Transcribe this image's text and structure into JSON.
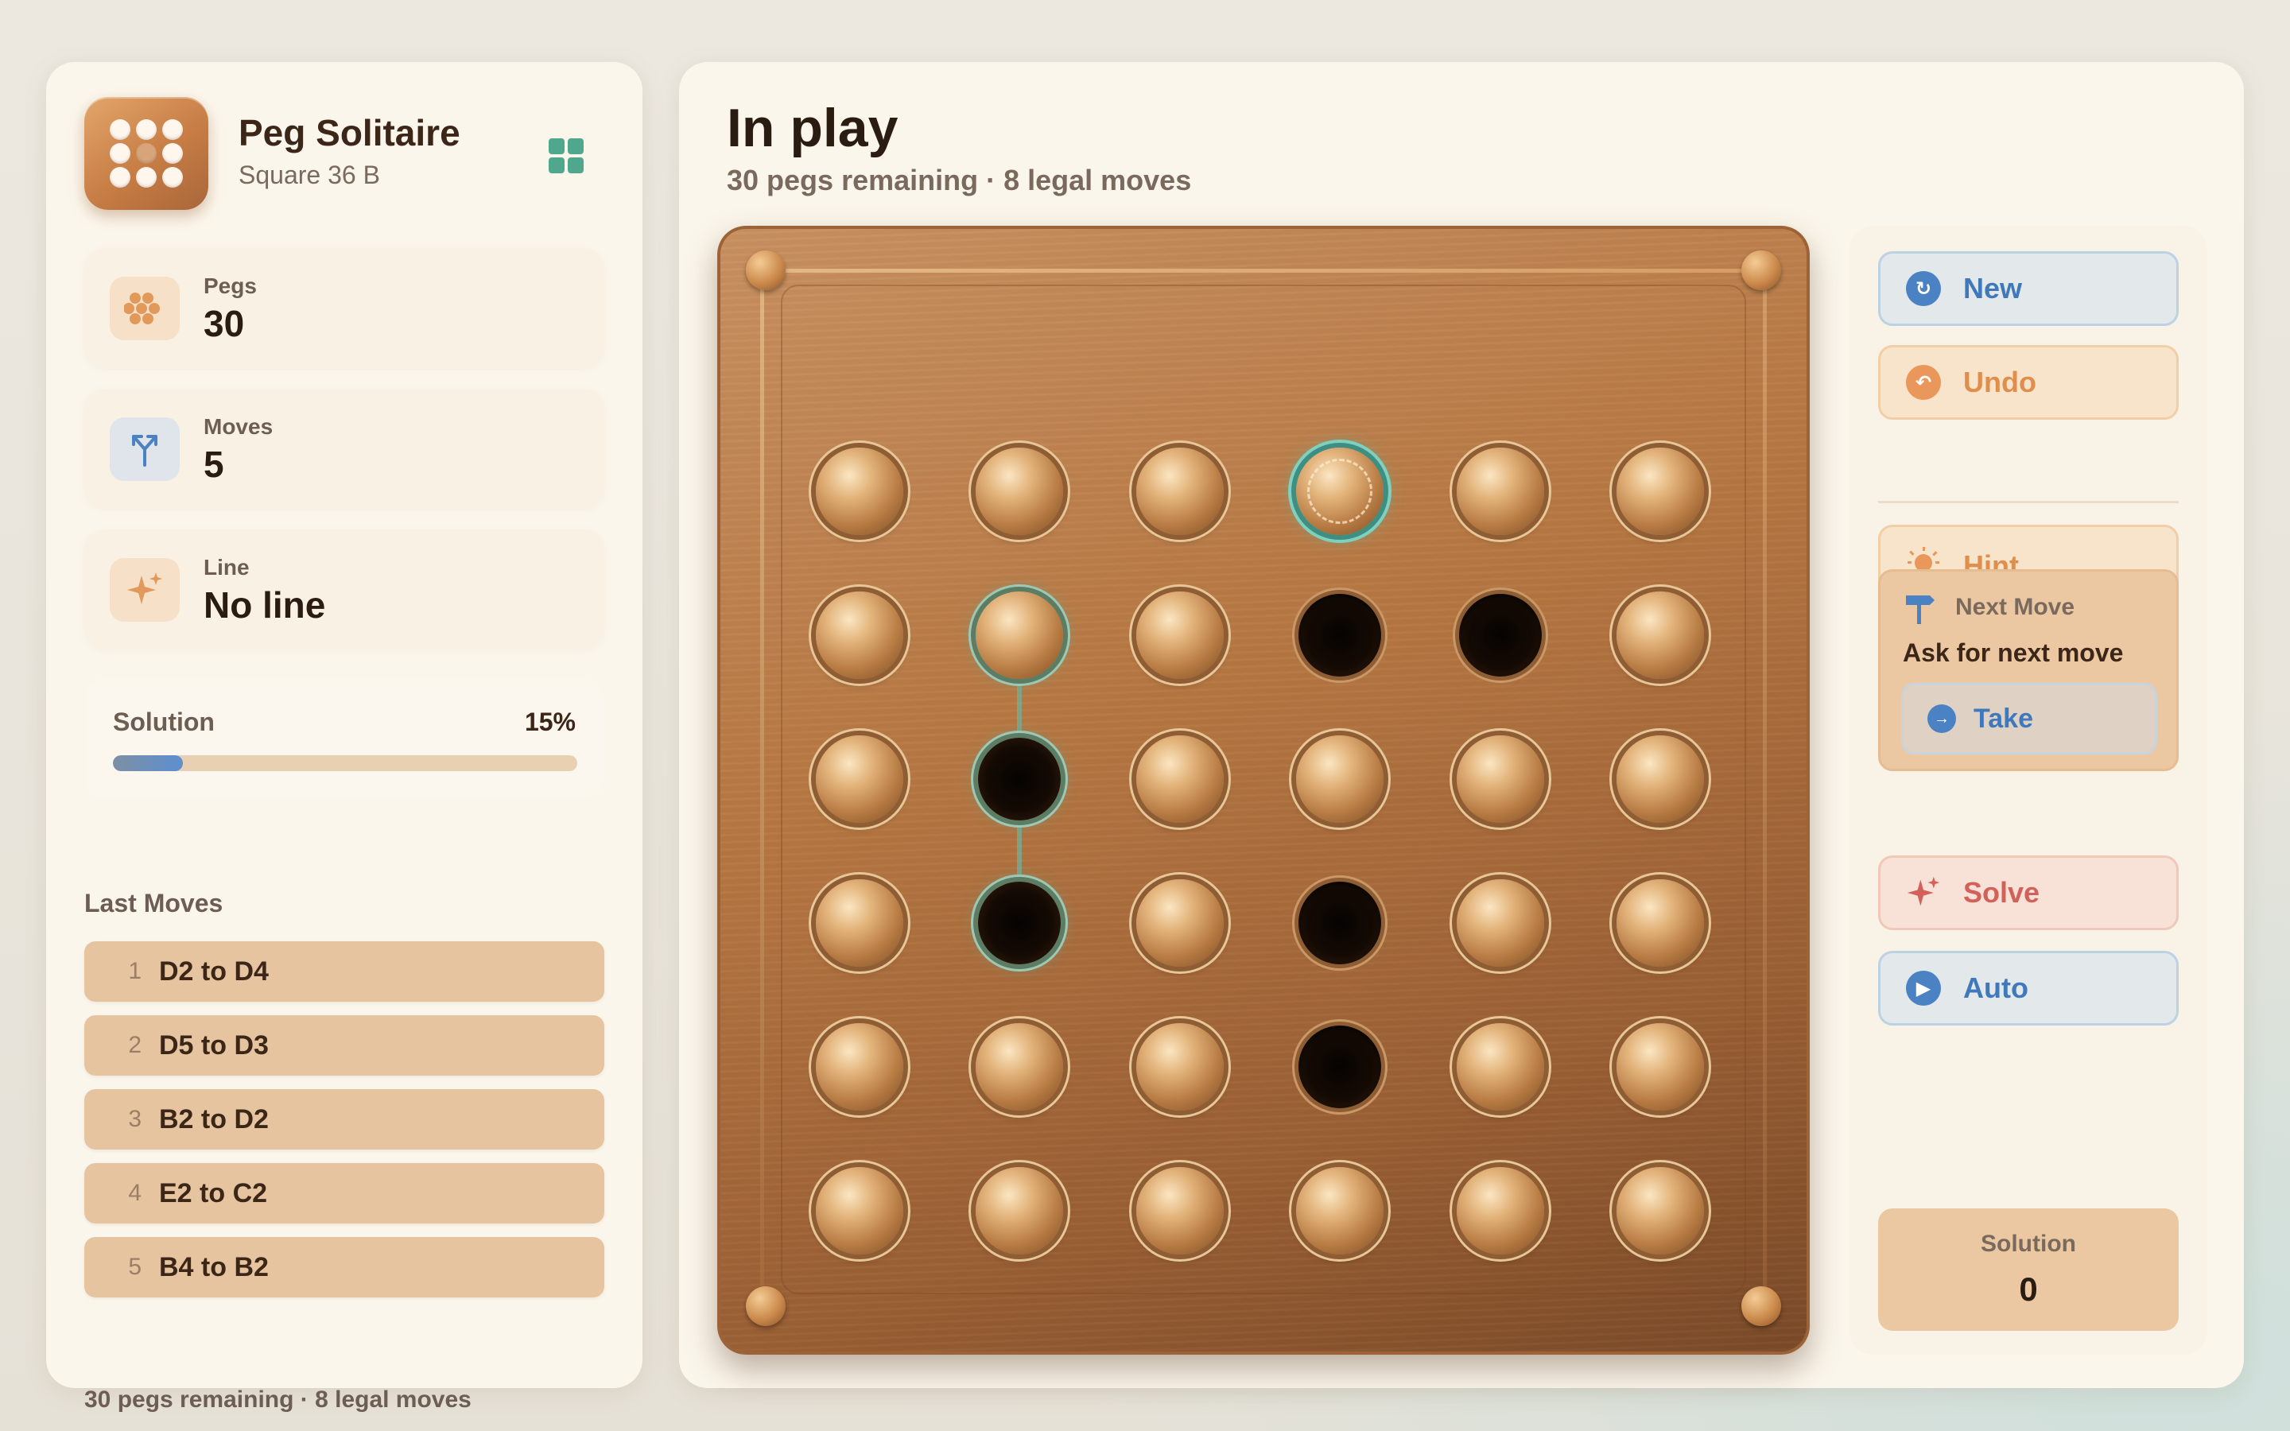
{
  "app": {
    "title": "Peg Solitaire",
    "subtitle": "Square 36 B"
  },
  "stats": {
    "pegs": {
      "label": "Pegs",
      "value": "30"
    },
    "moves": {
      "label": "Moves",
      "value": "5"
    },
    "line": {
      "label": "Line",
      "value": "No line"
    }
  },
  "solution_progress": {
    "label": "Solution",
    "percent_text": "15%",
    "fraction": 0.15
  },
  "last_moves": {
    "title": "Last Moves",
    "items": [
      {
        "num": "1",
        "text": "D2 to D4"
      },
      {
        "num": "2",
        "text": "D5 to D3"
      },
      {
        "num": "3",
        "text": "B2 to D2"
      },
      {
        "num": "4",
        "text": "E2 to C2"
      },
      {
        "num": "5",
        "text": "B4 to B2"
      }
    ]
  },
  "sidebar_footer": "30 pegs remaining · 8 legal moves",
  "main": {
    "title": "In play",
    "subtitle": "30 pegs remaining · 8 legal moves"
  },
  "board": {
    "rows": 6,
    "cols": 6,
    "cells": [
      [
        "peg",
        "peg",
        "peg",
        "peg",
        "peg",
        "peg"
      ],
      [
        "peg",
        "peg",
        "peg",
        "hole",
        "hole",
        "peg"
      ],
      [
        "peg",
        "hole",
        "peg",
        "peg",
        "peg",
        "peg"
      ],
      [
        "peg",
        "hole",
        "peg",
        "hole",
        "peg",
        "peg"
      ],
      [
        "peg",
        "peg",
        "peg",
        "hole",
        "peg",
        "peg"
      ],
      [
        "peg",
        "peg",
        "peg",
        "peg",
        "peg",
        "peg"
      ]
    ],
    "selected": [
      0,
      3
    ],
    "highlighted": [
      [
        1,
        1
      ],
      [
        2,
        1
      ],
      [
        3,
        1
      ]
    ]
  },
  "controls": {
    "new": "New",
    "undo": "Undo",
    "hint": "Hint",
    "next_move": {
      "title": "Next Move",
      "description": "Ask for next move",
      "take": "Take"
    },
    "solve": "Solve",
    "auto": "Auto",
    "solution": {
      "label": "Solution",
      "value": "0"
    }
  },
  "colors": {
    "accent_blue": "#4a82c4",
    "accent_orange": "#e9975a",
    "accent_red": "#d2615a",
    "accent_teal": "#4fa88e",
    "wood": "#b77843"
  }
}
